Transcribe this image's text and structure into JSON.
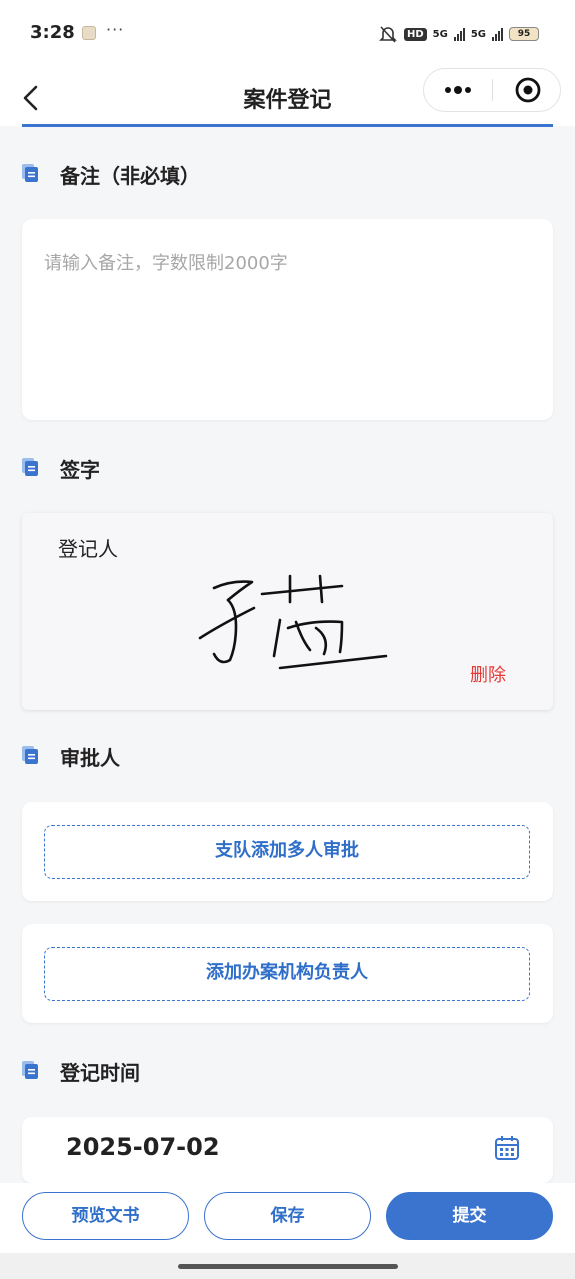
{
  "status_bar": {
    "time": "3:28",
    "notif_icon": "app-notification-icon",
    "more": "···",
    "hd_label": "HD",
    "signal_1": "5G",
    "signal_2": "5G",
    "battery": "95"
  },
  "nav": {
    "title": "案件登记",
    "back_icon": "chevron-left-icon",
    "more_icon": "more-dots-icon",
    "close_icon": "target-circle-icon"
  },
  "sections": {
    "remark": {
      "title": "备注（非必填）",
      "placeholder": "请输入备注，字数限制2000字",
      "value": ""
    },
    "signature": {
      "title": "签字",
      "signer_label": "登记人",
      "delete_label": "删除"
    },
    "approver": {
      "title": "审批人",
      "add_multi_label": "支队添加多人审批",
      "add_head_label": "添加办案机构负责人"
    },
    "reg_time": {
      "title": "登记时间",
      "date": "2025-07-02",
      "calendar_icon": "calendar-icon"
    }
  },
  "bottom_bar": {
    "preview_label": "预览文书",
    "save_label": "保存",
    "submit_label": "提交"
  },
  "colors": {
    "accent": "#3a74cf",
    "danger": "#e53935",
    "background": "#f5f6f8"
  }
}
